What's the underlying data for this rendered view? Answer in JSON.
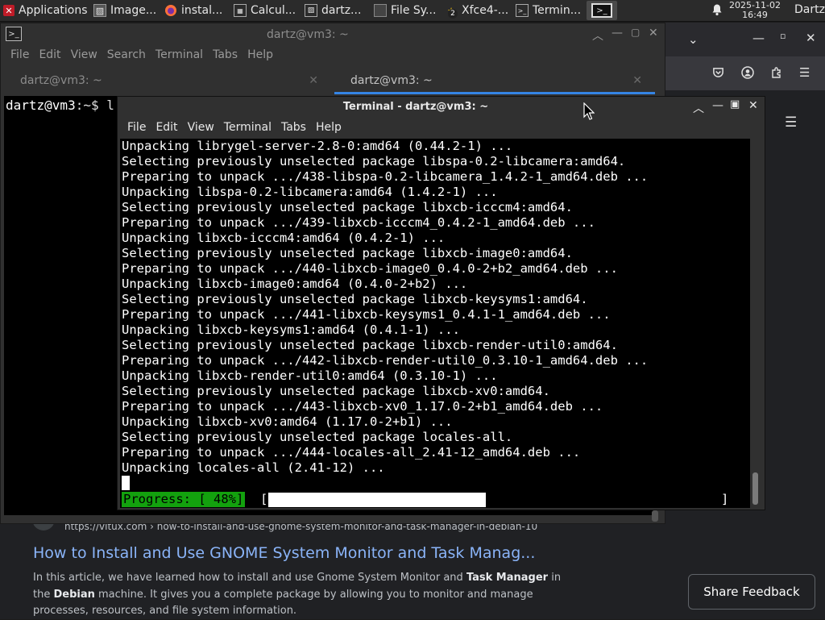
{
  "panel": {
    "apps_label": "Applications",
    "tasks": [
      {
        "label": "Image...",
        "icon": "image-viewer-icon"
      },
      {
        "label": "instal...",
        "icon": "firefox-icon"
      },
      {
        "label": "Calcul...",
        "icon": "calculator-icon"
      },
      {
        "label": "dartz...",
        "icon": "image-viewer-icon"
      },
      {
        "label": "File Sy...",
        "icon": "file-manager-icon"
      },
      {
        "label": "Xfce4-...",
        "icon": "xfce-icon",
        "badge": "2"
      },
      {
        "label": "Termin...",
        "icon": "terminal-icon"
      },
      {
        "label": "",
        "icon": "terminal-icon"
      }
    ],
    "clock_date": "2025-11-02",
    "clock_time": "16:49",
    "user": "Dartz"
  },
  "back_terminal": {
    "title": "dartz@vm3: ~",
    "menu": [
      "File",
      "Edit",
      "View",
      "Search",
      "Terminal",
      "Tabs",
      "Help"
    ],
    "tabs": [
      {
        "label": "dartz@vm3: ~",
        "selected": false
      },
      {
        "label": "dartz@vm3: ~",
        "selected": true
      }
    ],
    "prompt_user": "dartz@vm3",
    "prompt_rest": ":~$ l"
  },
  "front_terminal": {
    "title": "Terminal - dartz@vm3: ~",
    "menu": [
      "File",
      "Edit",
      "View",
      "Terminal",
      "Tabs",
      "Help"
    ],
    "lines": [
      "Unpacking librygel-server-2.8-0:amd64 (0.44.2-1) ...",
      "Selecting previously unselected package libspa-0.2-libcamera:amd64.",
      "Preparing to unpack .../438-libspa-0.2-libcamera_1.4.2-1_amd64.deb ...",
      "Unpacking libspa-0.2-libcamera:amd64 (1.4.2-1) ...",
      "Selecting previously unselected package libxcb-icccm4:amd64.",
      "Preparing to unpack .../439-libxcb-icccm4_0.4.2-1_amd64.deb ...",
      "Unpacking libxcb-icccm4:amd64 (0.4.2-1) ...",
      "Selecting previously unselected package libxcb-image0:amd64.",
      "Preparing to unpack .../440-libxcb-image0_0.4.0-2+b2_amd64.deb ...",
      "Unpacking libxcb-image0:amd64 (0.4.0-2+b2) ...",
      "Selecting previously unselected package libxcb-keysyms1:amd64.",
      "Preparing to unpack .../441-libxcb-keysyms1_0.4.1-1_amd64.deb ...",
      "Unpacking libxcb-keysyms1:amd64 (0.4.1-1) ...",
      "Selecting previously unselected package libxcb-render-util0:amd64.",
      "Preparing to unpack .../442-libxcb-render-util0_0.3.10-1_amd64.deb ...",
      "Unpacking libxcb-render-util0:amd64 (0.3.10-1) ...",
      "Selecting previously unselected package libxcb-xv0:amd64.",
      "Preparing to unpack .../443-libxcb-xv0_1.17.0-2+b1_amd64.deb ...",
      "Unpacking libxcb-xv0:amd64 (1.17.0-2+b1) ...",
      "Selecting previously unselected package locales-all.",
      "Preparing to unpack .../444-locales-all_2.41-12_amd64.deb ...",
      "Unpacking locales-all (2.41-12) ..."
    ],
    "progress_label": "Progress: [ 48%]",
    "progress_fraction": 0.48,
    "bracket_open": "[",
    "bracket_close": "]"
  },
  "web_page": {
    "url": "https://vitux.com › how-to-install-and-use-gnome-system-monitor-and-task-manager-in-debian-10",
    "title": "How to Install and Use GNOME System Monitor and Task Manag...",
    "desc_1": "In this article, we have learned how to install and use Gnome System Monitor and ",
    "desc_b1": "Task Manager",
    "desc_2": " in the ",
    "desc_b2": "Debian",
    "desc_3": " machine. It gives you a complete package by allowing you to monitor and manage processes, resources, and file system information.",
    "share_label": "Share Feedback"
  },
  "colors": {
    "progress_green": "#13a10e",
    "tab_accent": "#3584e4",
    "link_blue": "#8ab4f8"
  }
}
